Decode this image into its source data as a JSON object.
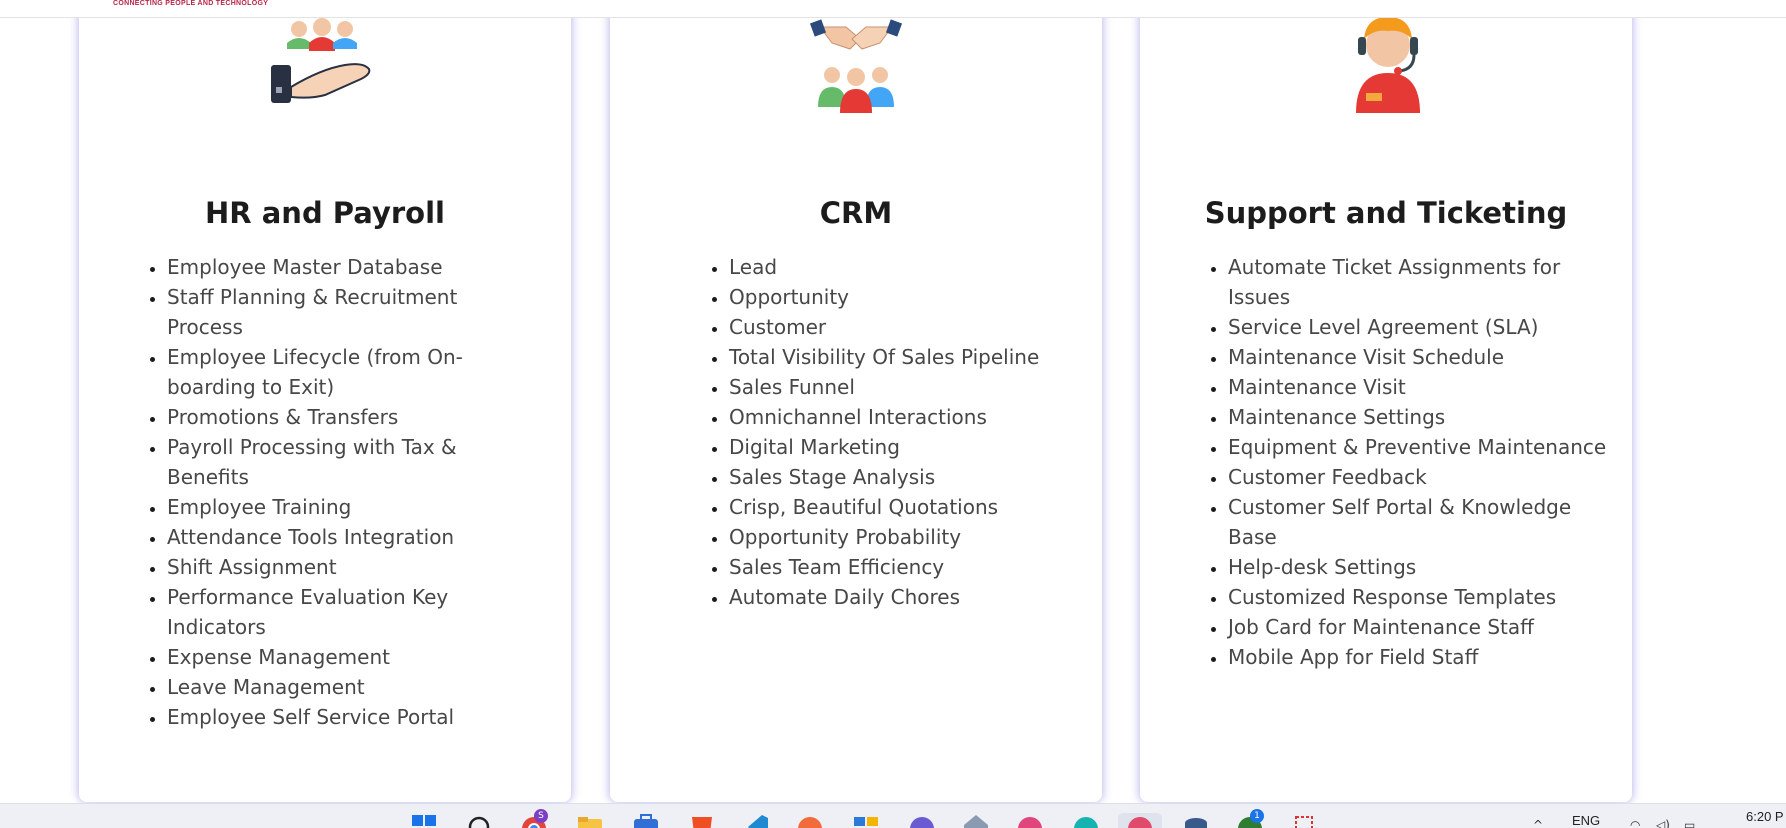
{
  "header": {
    "tagline": "CONNECTING PEOPLE AND TECHNOLOGY"
  },
  "cards": [
    {
      "title": "HR and Payroll",
      "icon": "people-in-hand-icon",
      "items": [
        "Employee Master Database",
        "Staff Planning & Recruitment Process",
        "Employee Lifecycle (from On-boarding to Exit)",
        "Promotions & Transfers",
        "Payroll Processing with Tax & Benefits",
        "Employee Training",
        "Attendance Tools Integration",
        "Shift Assignment",
        "Performance Evaluation Key Indicators",
        "Expense Management",
        "Leave Management",
        "Employee Self Service Portal"
      ]
    },
    {
      "title": "CRM",
      "icon": "handshake-team-icon",
      "items": [
        "Lead",
        "Opportunity",
        "Customer",
        "Total Visibility Of Sales Pipeline",
        "Sales Funnel",
        "Omnichannel Interactions",
        "Digital Marketing",
        "Sales Stage Analysis",
        "Crisp, Beautiful Quotations",
        "Opportunity Probability",
        "Sales Team Efficiency",
        "Automate Daily Chores"
      ]
    },
    {
      "title": "Support and Ticketing",
      "icon": "support-agent-headset-icon",
      "items": [
        "Automate Ticket Assignments for Issues",
        "Service Level Agreement (SLA)",
        "Maintenance Visit Schedule",
        "Maintenance Visit",
        "Maintenance Settings",
        "Equipment & Preventive Maintenance",
        "Customer Feedback",
        "Customer Self Portal & Knowledge Base",
        "Help-desk Settings",
        "Customized Response Templates",
        "Job Card for Maintenance Staff",
        "Mobile App for Field Staff"
      ]
    }
  ],
  "taskbar": {
    "language": "ENG",
    "time": "6:20 P",
    "badge_chrome": "S",
    "badge_notify": "1"
  },
  "colors": {
    "card_shadow": "#786edc",
    "taskbar_bg": "#eef0f6",
    "tagline": "#b8234a"
  }
}
